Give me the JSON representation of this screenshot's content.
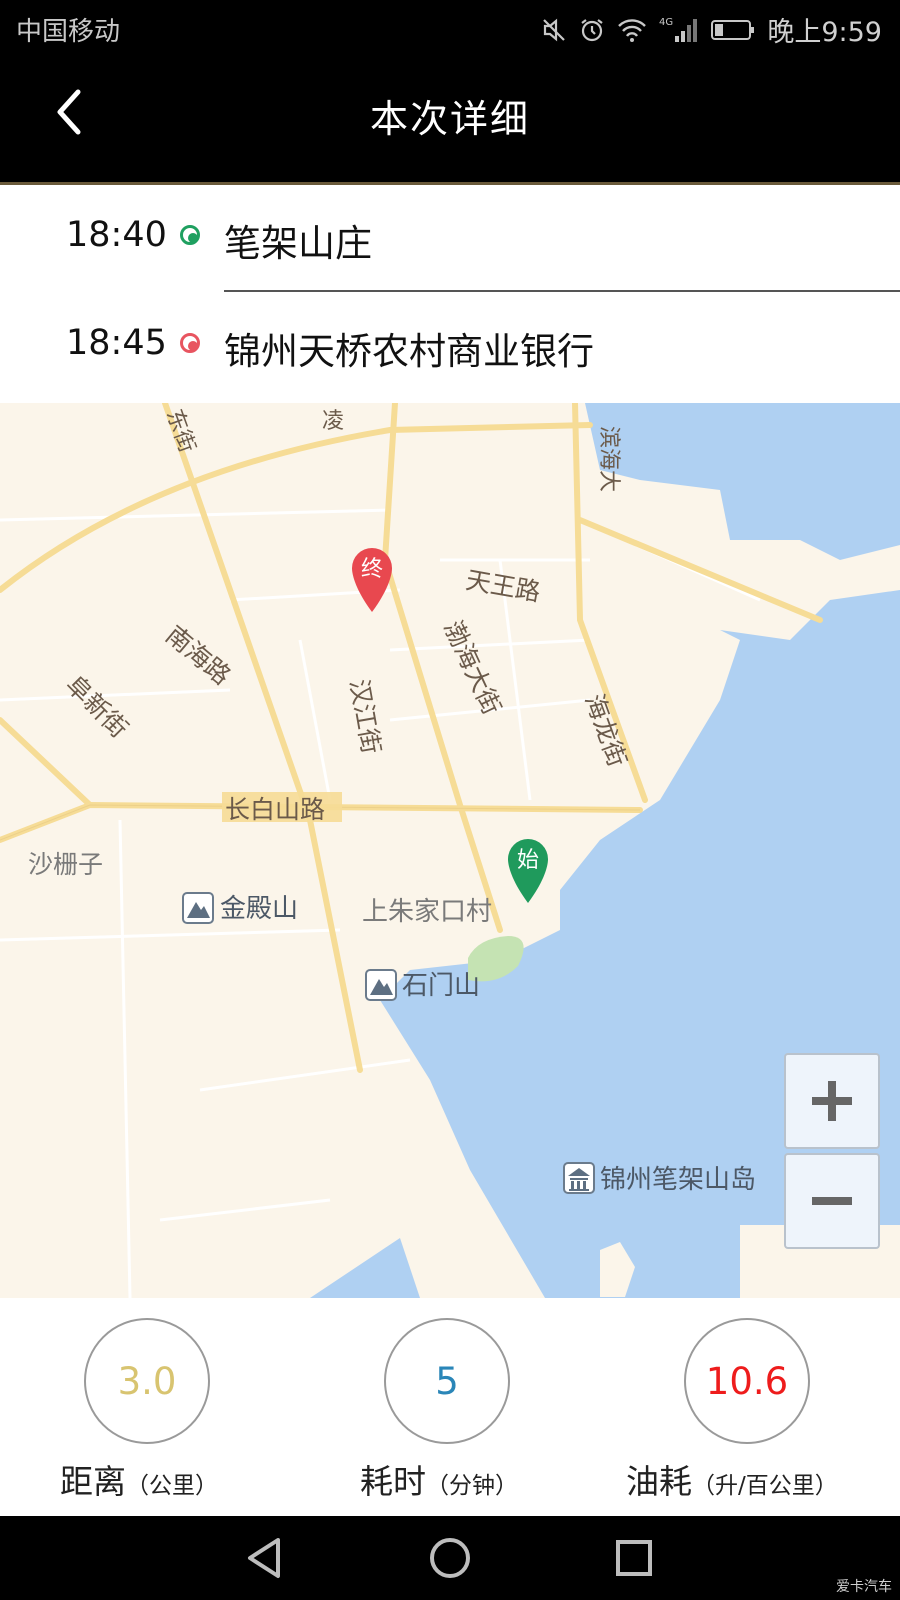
{
  "status_bar": {
    "carrier": "中国移动",
    "network": "4G",
    "time": "晚上9:59",
    "icons": [
      "mute-icon",
      "alarm-icon",
      "wifi-icon",
      "signal-icon",
      "battery-icon"
    ]
  },
  "header": {
    "title": "本次详细",
    "back_icon": "chevron-left-icon"
  },
  "route": {
    "start": {
      "time": "18:40",
      "place": "笔架山庄",
      "color": "#1fa060"
    },
    "end": {
      "time": "18:45",
      "place": "锦州天桥农村商业银行",
      "color": "#e85560"
    }
  },
  "map": {
    "colors": {
      "land": "#fbf5ea",
      "water": "#afd0f2",
      "road_major": "#f6dc96",
      "road_minor": "#ffffff",
      "park": "#c5e3b3"
    },
    "labels": {
      "dongjie": "东街",
      "ling": "凌",
      "binhai": "滨海大",
      "tianwanglu": "天王路",
      "nanhailu": "南海路",
      "bohaidajie": "渤海大街",
      "hanjiangjie": "汉江街",
      "fuxinjie": "阜新街",
      "hailongjie": "海龙街",
      "changbaishanlu": "长白山路",
      "shazhazi": "沙栅子",
      "jindianshan": "金殿山",
      "shangzhujiakoucun": "上朱家口村",
      "shimenshan": "石门山",
      "bijiashandao": "锦州笔架山岛"
    },
    "markers": {
      "start": "始",
      "end": "终"
    },
    "zoom": {
      "in": "+",
      "out": "−"
    }
  },
  "stats": {
    "distance": {
      "value": "3.0",
      "label": "距离",
      "unit": "（公里）",
      "color": "#d8c470"
    },
    "duration": {
      "value": "5",
      "label": "耗时",
      "unit": "（分钟）",
      "color": "#2a86b8"
    },
    "fuel": {
      "value": "10.6",
      "label": "油耗",
      "unit": "（升/百公里）",
      "color": "#ee1c1c"
    }
  },
  "nav": {
    "back": "nav-back-icon",
    "home": "nav-home-icon",
    "recent": "nav-recent-icon"
  },
  "watermark": "爱卡汽车"
}
